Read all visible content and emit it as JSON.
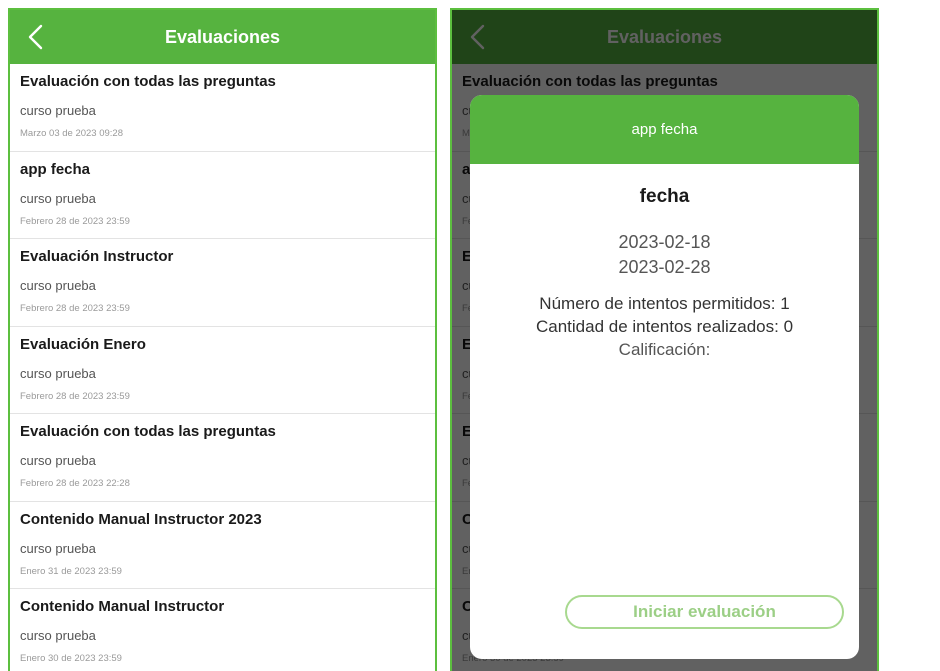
{
  "header": {
    "title": "Evaluaciones"
  },
  "evaluations": [
    {
      "name": "Evaluación con todas las preguntas",
      "course": "curso prueba",
      "date": "Marzo 03 de 2023 09:28"
    },
    {
      "name": "app fecha",
      "course": "curso prueba",
      "date": "Febrero 28 de 2023 23:59"
    },
    {
      "name": "Evaluación Instructor",
      "course": "curso prueba",
      "date": "Febrero 28 de 2023 23:59"
    },
    {
      "name": "Evaluación Enero",
      "course": "curso prueba",
      "date": "Febrero 28 de 2023 23:59"
    },
    {
      "name": "Evaluación con todas las preguntas",
      "course": "curso prueba",
      "date": "Febrero 28 de 2023 22:28"
    },
    {
      "name": "Contenido Manual Instructor 2023",
      "course": "curso prueba",
      "date": "Enero 31 de 2023 23:59"
    },
    {
      "name": "Contenido Manual Instructor",
      "course": "curso prueba",
      "date": "Enero 30 de 2023 23:59"
    }
  ],
  "dialog": {
    "header": "app fecha",
    "title": "fecha",
    "start_date": "2023-02-18",
    "end_date": "2023-02-28",
    "allowed_attempts": "Número de intentos permitidos: 1",
    "attempts_made": "Cantidad de intentos realizados: 0",
    "grade": "Calificación:",
    "start_button": "Iniciar evaluación"
  },
  "colors": {
    "brand_green": "#56b33f",
    "border_green": "#5cbf3f"
  },
  "icons": {
    "back": "chevron-left-icon"
  }
}
